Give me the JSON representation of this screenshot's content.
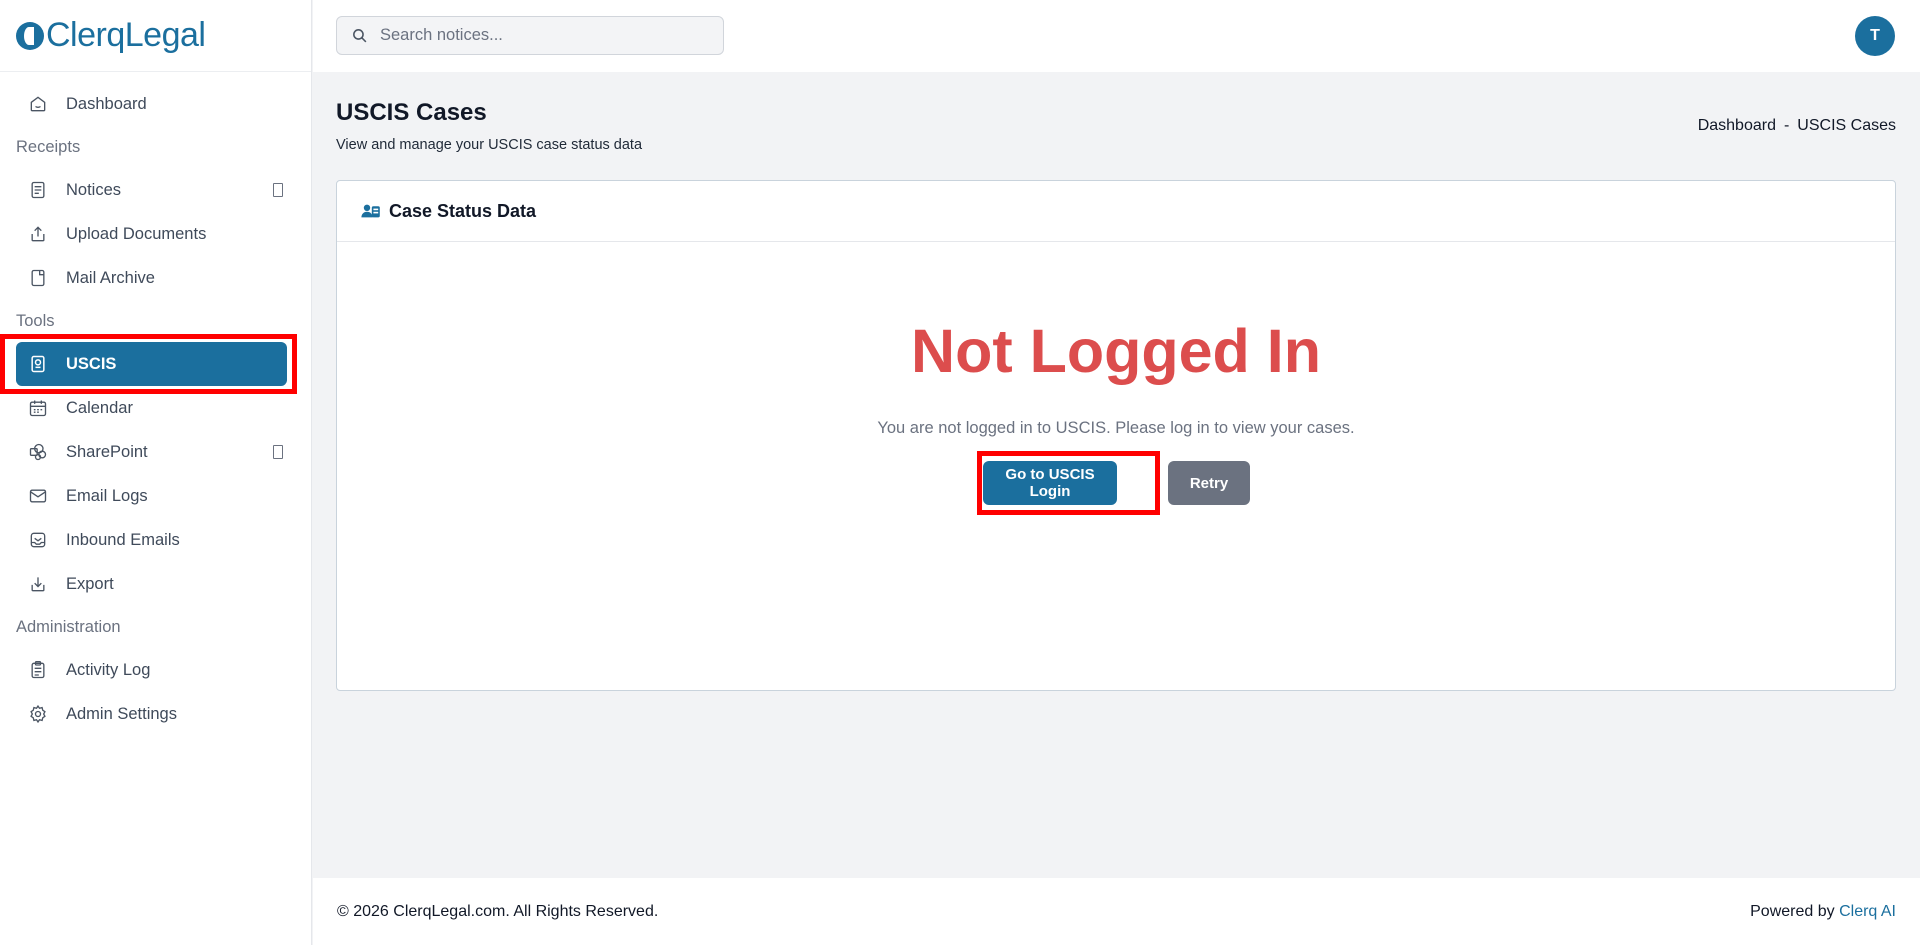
{
  "brand": {
    "name": "ClerqLegal"
  },
  "search": {
    "placeholder": "Search notices..."
  },
  "user": {
    "initial": "T"
  },
  "sidebar": {
    "items": [
      {
        "label": "Dashboard",
        "icon": "home-icon"
      },
      {
        "section": "Receipts"
      },
      {
        "label": "Notices",
        "icon": "document-icon",
        "has_submenu": true
      },
      {
        "label": "Upload Documents",
        "icon": "upload-icon"
      },
      {
        "label": "Mail Archive",
        "icon": "mail-archive-icon"
      },
      {
        "section": "Tools"
      },
      {
        "label": "USCIS",
        "icon": "passport-icon",
        "active": true
      },
      {
        "label": "Calendar",
        "icon": "calendar-icon"
      },
      {
        "label": "SharePoint",
        "icon": "sharepoint-icon",
        "has_submenu": true
      },
      {
        "label": "Email Logs",
        "icon": "envelope-icon"
      },
      {
        "label": "Inbound Emails",
        "icon": "inbox-icon"
      },
      {
        "label": "Export",
        "icon": "download-icon"
      },
      {
        "section": "Administration"
      },
      {
        "label": "Activity Log",
        "icon": "clipboard-icon"
      },
      {
        "label": "Admin Settings",
        "icon": "gear-icon"
      }
    ]
  },
  "page": {
    "title": "USCIS Cases",
    "subtitle": "View and manage your USCIS case status data",
    "breadcrumb": [
      "Dashboard",
      "-",
      "USCIS Cases"
    ]
  },
  "card": {
    "title": "Case Status Data",
    "status_title": "Not Logged In",
    "message": "You are not logged in to USCIS. Please log in to view your cases.",
    "login_button": "Go to USCIS Login",
    "retry_button": "Retry"
  },
  "footer": {
    "copyright": "© 2026 ClerqLegal.com. All Rights Reserved.",
    "powered_by": "Powered by",
    "powered_link": "Clerq AI"
  },
  "colors": {
    "brand": "#1b6f9e",
    "error": "#dc4d4d",
    "secondary_button": "#6b7280",
    "highlight": "#ff0000"
  }
}
